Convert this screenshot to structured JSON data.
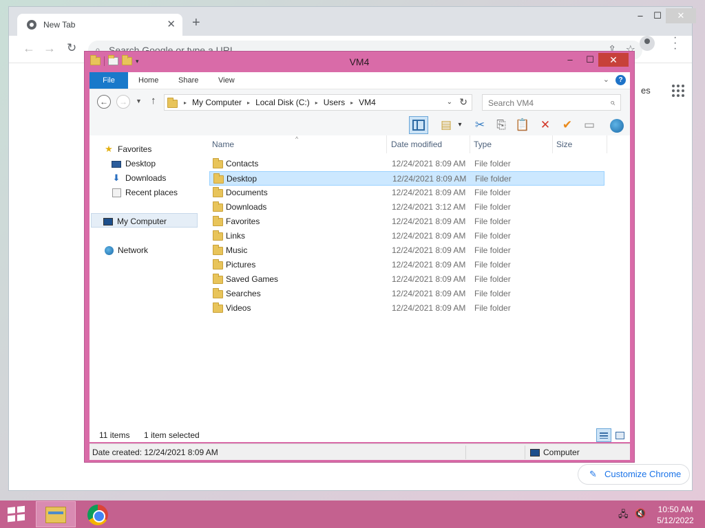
{
  "chrome": {
    "tab_title": "New Tab",
    "new_tab_symbol": "+",
    "omnibox_placeholder": "Search Google or type a URL",
    "apps_text": "es",
    "customize_label": "Customize Chrome",
    "window_controls": {
      "minimize": "–",
      "maximize": "☐",
      "close": "✕"
    }
  },
  "explorer": {
    "title": "VM4",
    "ribbon_tabs": [
      "File",
      "Home",
      "Share",
      "View"
    ],
    "address_crumbs": [
      "My Computer",
      "Local Disk (C:)",
      "Users",
      "VM4"
    ],
    "search_placeholder": "Search VM4",
    "nav": {
      "favorites": "Favorites",
      "desktop": "Desktop",
      "downloads": "Downloads",
      "recent": "Recent places",
      "computer": "My Computer",
      "network": "Network"
    },
    "columns": {
      "name": "Name",
      "date": "Date modified",
      "type": "Type",
      "size": "Size"
    },
    "files": [
      {
        "name": "Contacts",
        "date": "12/24/2021 8:09 AM",
        "type": "File folder",
        "selected": false
      },
      {
        "name": "Desktop",
        "date": "12/24/2021 8:09 AM",
        "type": "File folder",
        "selected": true
      },
      {
        "name": "Documents",
        "date": "12/24/2021 8:09 AM",
        "type": "File folder",
        "selected": false
      },
      {
        "name": "Downloads",
        "date": "12/24/2021 3:12 AM",
        "type": "File folder",
        "selected": false
      },
      {
        "name": "Favorites",
        "date": "12/24/2021 8:09 AM",
        "type": "File folder",
        "selected": false
      },
      {
        "name": "Links",
        "date": "12/24/2021 8:09 AM",
        "type": "File folder",
        "selected": false
      },
      {
        "name": "Music",
        "date": "12/24/2021 8:09 AM",
        "type": "File folder",
        "selected": false
      },
      {
        "name": "Pictures",
        "date": "12/24/2021 8:09 AM",
        "type": "File folder",
        "selected": false
      },
      {
        "name": "Saved Games",
        "date": "12/24/2021 8:09 AM",
        "type": "File folder",
        "selected": false
      },
      {
        "name": "Searches",
        "date": "12/24/2021 8:09 AM",
        "type": "File folder",
        "selected": false
      },
      {
        "name": "Videos",
        "date": "12/24/2021 8:09 AM",
        "type": "File folder",
        "selected": false
      }
    ],
    "status": {
      "items": "11 items",
      "selected": "1 item selected"
    },
    "details": {
      "date_created": "Date created: 12/24/2021 8:09 AM",
      "location": "Computer"
    },
    "accent_color": "#d96ba8"
  },
  "taskbar": {
    "time": "10:50 AM",
    "date": "5/12/2022",
    "color": "#c4618f"
  }
}
